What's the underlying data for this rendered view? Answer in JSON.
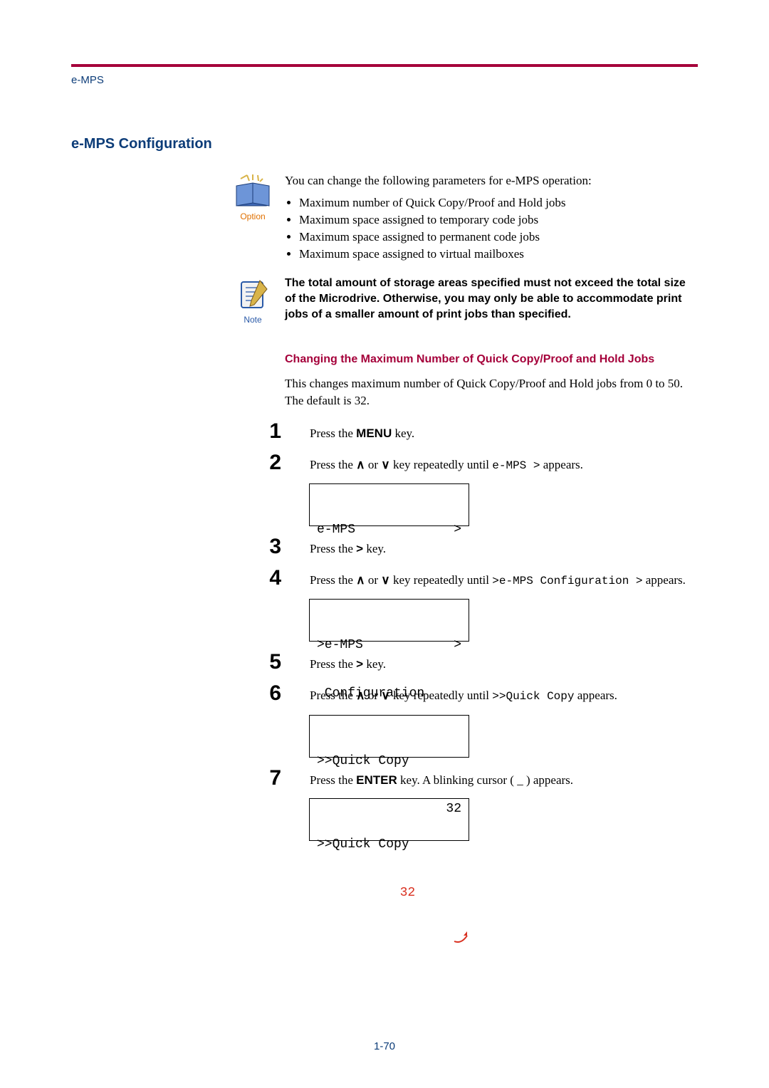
{
  "header": {
    "label": "e-MPS"
  },
  "section": {
    "title": "e-MPS Configuration"
  },
  "option_icon": {
    "label": "Option",
    "name": "option-book-icon"
  },
  "note_icon": {
    "label": "Note",
    "name": "note-pad-icon"
  },
  "intro": {
    "lead": "You can change the following parameters for e-MPS operation:",
    "bullets": [
      "Maximum number of Quick Copy/Proof and Hold jobs",
      "Maximum space assigned to temporary code jobs",
      "Maximum space assigned to permanent code jobs",
      "Maximum space assigned to virtual mailboxes"
    ]
  },
  "note_text": "The total amount of storage areas specified must not exceed the total size of the Microdrive. Otherwise, you may only be able to accommodate print jobs of a smaller amount of print jobs than specified.",
  "sub": {
    "heading": "Changing the Maximum Number of Quick Copy/Proof and Hold Jobs",
    "body": "This changes maximum number of Quick Copy/Proof and Hold jobs from 0 to 50. The default is 32."
  },
  "steps": {
    "s1": {
      "num": "1",
      "prefix": "Press the ",
      "key": "MENU",
      "suffix": " key."
    },
    "s2": {
      "num": "2",
      "prefix": "Press the ",
      "mid": " or ",
      "mid2": " key repeatedly until ",
      "mono": "e-MPS >",
      "suffix": " appears.",
      "lcd_line1_left": "e-MPS",
      "lcd_line1_right": ">"
    },
    "s3": {
      "num": "3",
      "prefix": "Press the ",
      "key": ">",
      "suffix": " key."
    },
    "s4": {
      "num": "4",
      "prefix": "Press the ",
      "mid": " or ",
      "mid2": " key repeatedly until ",
      "mono": ">e-MPS Configuration >",
      "suffix": " appears.",
      "lcd_line1_left": ">e-MPS",
      "lcd_line1_right": ">",
      "lcd_line2": " Configuration"
    },
    "s5": {
      "num": "5",
      "prefix": "Press the ",
      "key": ">",
      "suffix": " key."
    },
    "s6": {
      "num": "6",
      "prefix": "Press the ",
      "mid": " or ",
      "mid2": " key repeatedly until ",
      "mono": ">>Quick Copy",
      "suffix": " appears.",
      "lcd_line1": ">>Quick Copy",
      "lcd_line2_right": "32"
    },
    "s7": {
      "num": "7",
      "prefix": "Press the ",
      "key": "ENTER",
      "suffix": " key. A blinking cursor ( _ ) appears.",
      "lcd_line1": ">>Quick Copy",
      "lcd_line2_right": "32"
    }
  },
  "page_number": "1-70",
  "glyphs": {
    "up": "∧",
    "down": "∨"
  }
}
